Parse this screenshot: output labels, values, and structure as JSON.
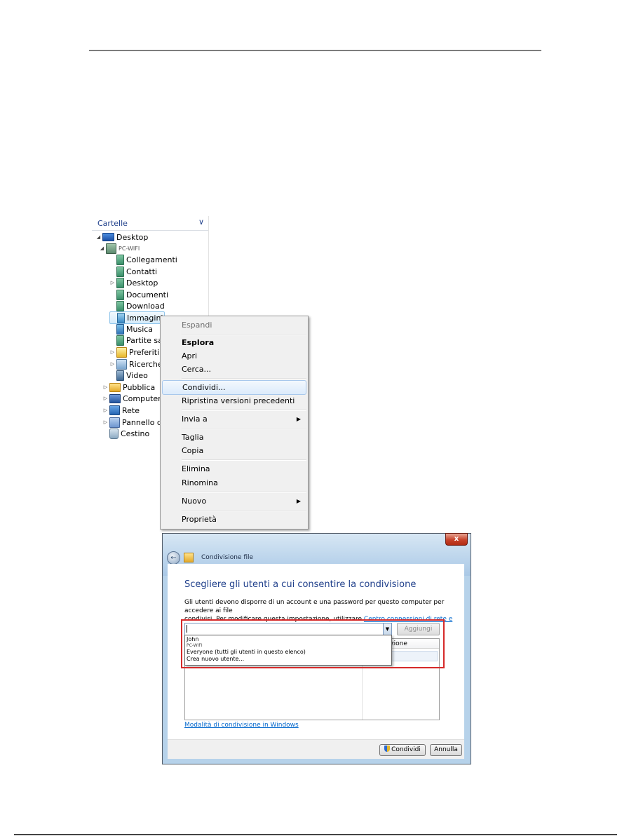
{
  "tree": {
    "header": "Cartelle",
    "items": [
      {
        "label": "Desktop",
        "icon": "desktop-icon"
      },
      {
        "label": "PC-WIFI",
        "icon": "user-folder-icon"
      },
      {
        "label": "Collegamenti",
        "icon": "library-folder-icon"
      },
      {
        "label": "Contatti",
        "icon": "contacts-folder-icon"
      },
      {
        "label": "Desktop",
        "icon": "desktop-folder-icon"
      },
      {
        "label": "Documenti",
        "icon": "documents-folder-icon"
      },
      {
        "label": "Download",
        "icon": "download-folder-icon"
      },
      {
        "label": "Immagini",
        "icon": "pictures-folder-icon"
      },
      {
        "label": "Musica",
        "icon": "music-folder-icon"
      },
      {
        "label": "Partite sal",
        "icon": "saved-games-folder-icon"
      },
      {
        "label": "Preferiti",
        "icon": "favorites-folder-icon"
      },
      {
        "label": "Ricerche",
        "icon": "searches-folder-icon"
      },
      {
        "label": "Video",
        "icon": "videos-folder-icon"
      },
      {
        "label": "Pubblica",
        "icon": "public-folder-icon"
      },
      {
        "label": "Computer",
        "icon": "computer-icon"
      },
      {
        "label": "Rete",
        "icon": "network-icon"
      },
      {
        "label": "Pannello di",
        "icon": "control-panel-icon"
      },
      {
        "label": "Cestino",
        "icon": "recycle-bin-icon"
      }
    ]
  },
  "context_menu": {
    "expand": "Espandi",
    "explore": "Esplora",
    "open": "Apri",
    "search": "Cerca...",
    "share": "Condividi...",
    "restore": "Ripristina versioni precedenti",
    "send_to": "Invia a",
    "cut": "Taglia",
    "copy": "Copia",
    "delete": "Elimina",
    "rename": "Rinomina",
    "new": "Nuovo",
    "properties": "Proprietà"
  },
  "dialog": {
    "title": "Condivisione file",
    "close": "x",
    "heading": "Scegliere gli utenti a cui consentire la condivisione",
    "desc_line1": "Gli utenti devono disporre di un account e una password per questo computer per accedere ai file",
    "desc_line2_prefix": "condivisi. Per modificare questa impostazione, utilizzare ",
    "desc_link": "Centro connessioni di rete e condivisione",
    "desc_suffix": ".",
    "add_button": "Aggiungi",
    "column_header": "utorizzazione",
    "dropdown": {
      "john": "John",
      "pc": "PC-WIFI",
      "everyone": "Everyone (tutti gli utenti in questo elenco)",
      "create": "Crea nuovo utente..."
    },
    "help_link": "Modalità di condivisione in Windows",
    "share_button": "Condividi",
    "cancel_button": "Annulla"
  }
}
